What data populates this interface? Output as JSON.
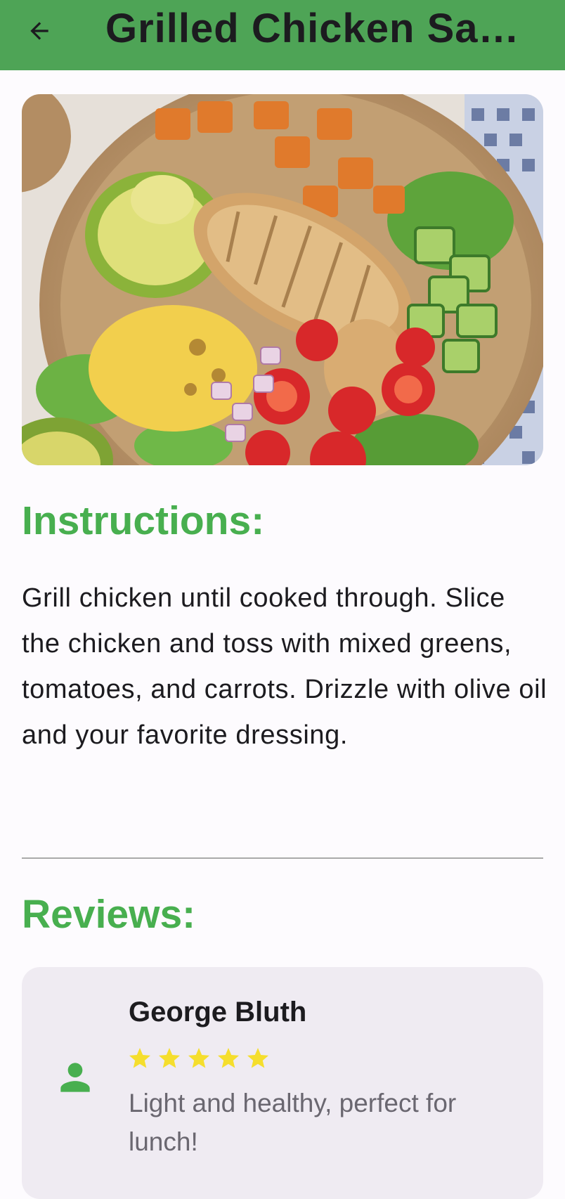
{
  "appbar": {
    "title": "Grilled Chicken Sa…",
    "back_icon": "arrow-left-icon",
    "background": "#4ea456"
  },
  "hero": {
    "image": "grilled-chicken-salad-photo"
  },
  "instructions": {
    "heading": "Instructions:",
    "text": "Grill chicken until cooked through. Slice the chicken and toss with mixed greens, tomatoes, and carrots. Drizzle with olive oil and your favorite dressing."
  },
  "reviews": {
    "heading": "Reviews:",
    "items": [
      {
        "name": "George Bluth",
        "rating": 5,
        "comment": "Light and healthy, perfect for lunch!",
        "avatar_icon": "person-icon"
      }
    ]
  },
  "colors": {
    "accent": "#48af4f",
    "star": "#f5de2d",
    "card": "#efebf2"
  }
}
